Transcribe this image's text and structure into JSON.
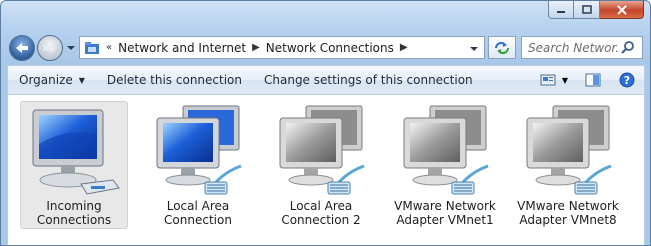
{
  "window": {
    "caption_buttons": [
      "minimize",
      "maximize",
      "close"
    ]
  },
  "address": {
    "overflow": "«",
    "crumbs": [
      "Network and Internet",
      "Network Connections"
    ]
  },
  "search": {
    "placeholder": "Search Networ..."
  },
  "toolbar": {
    "organize": "Organize",
    "delete": "Delete this connection",
    "change": "Change settings of this connection"
  },
  "connections": [
    {
      "label": "Incoming\nConnections",
      "type": "incoming",
      "selected": true
    },
    {
      "label": "Local Area\nConnection",
      "type": "active"
    },
    {
      "label": "Local Area\nConnection 2",
      "type": "disabled"
    },
    {
      "label": "VMware Network\nAdapter VMnet1",
      "type": "disabled"
    },
    {
      "label": "VMware Network\nAdapter VMnet8",
      "type": "disabled"
    }
  ],
  "colors": {
    "accent": "#2d6fd6",
    "frame": "#a9c7e6",
    "selection": "#e8e8e8"
  }
}
